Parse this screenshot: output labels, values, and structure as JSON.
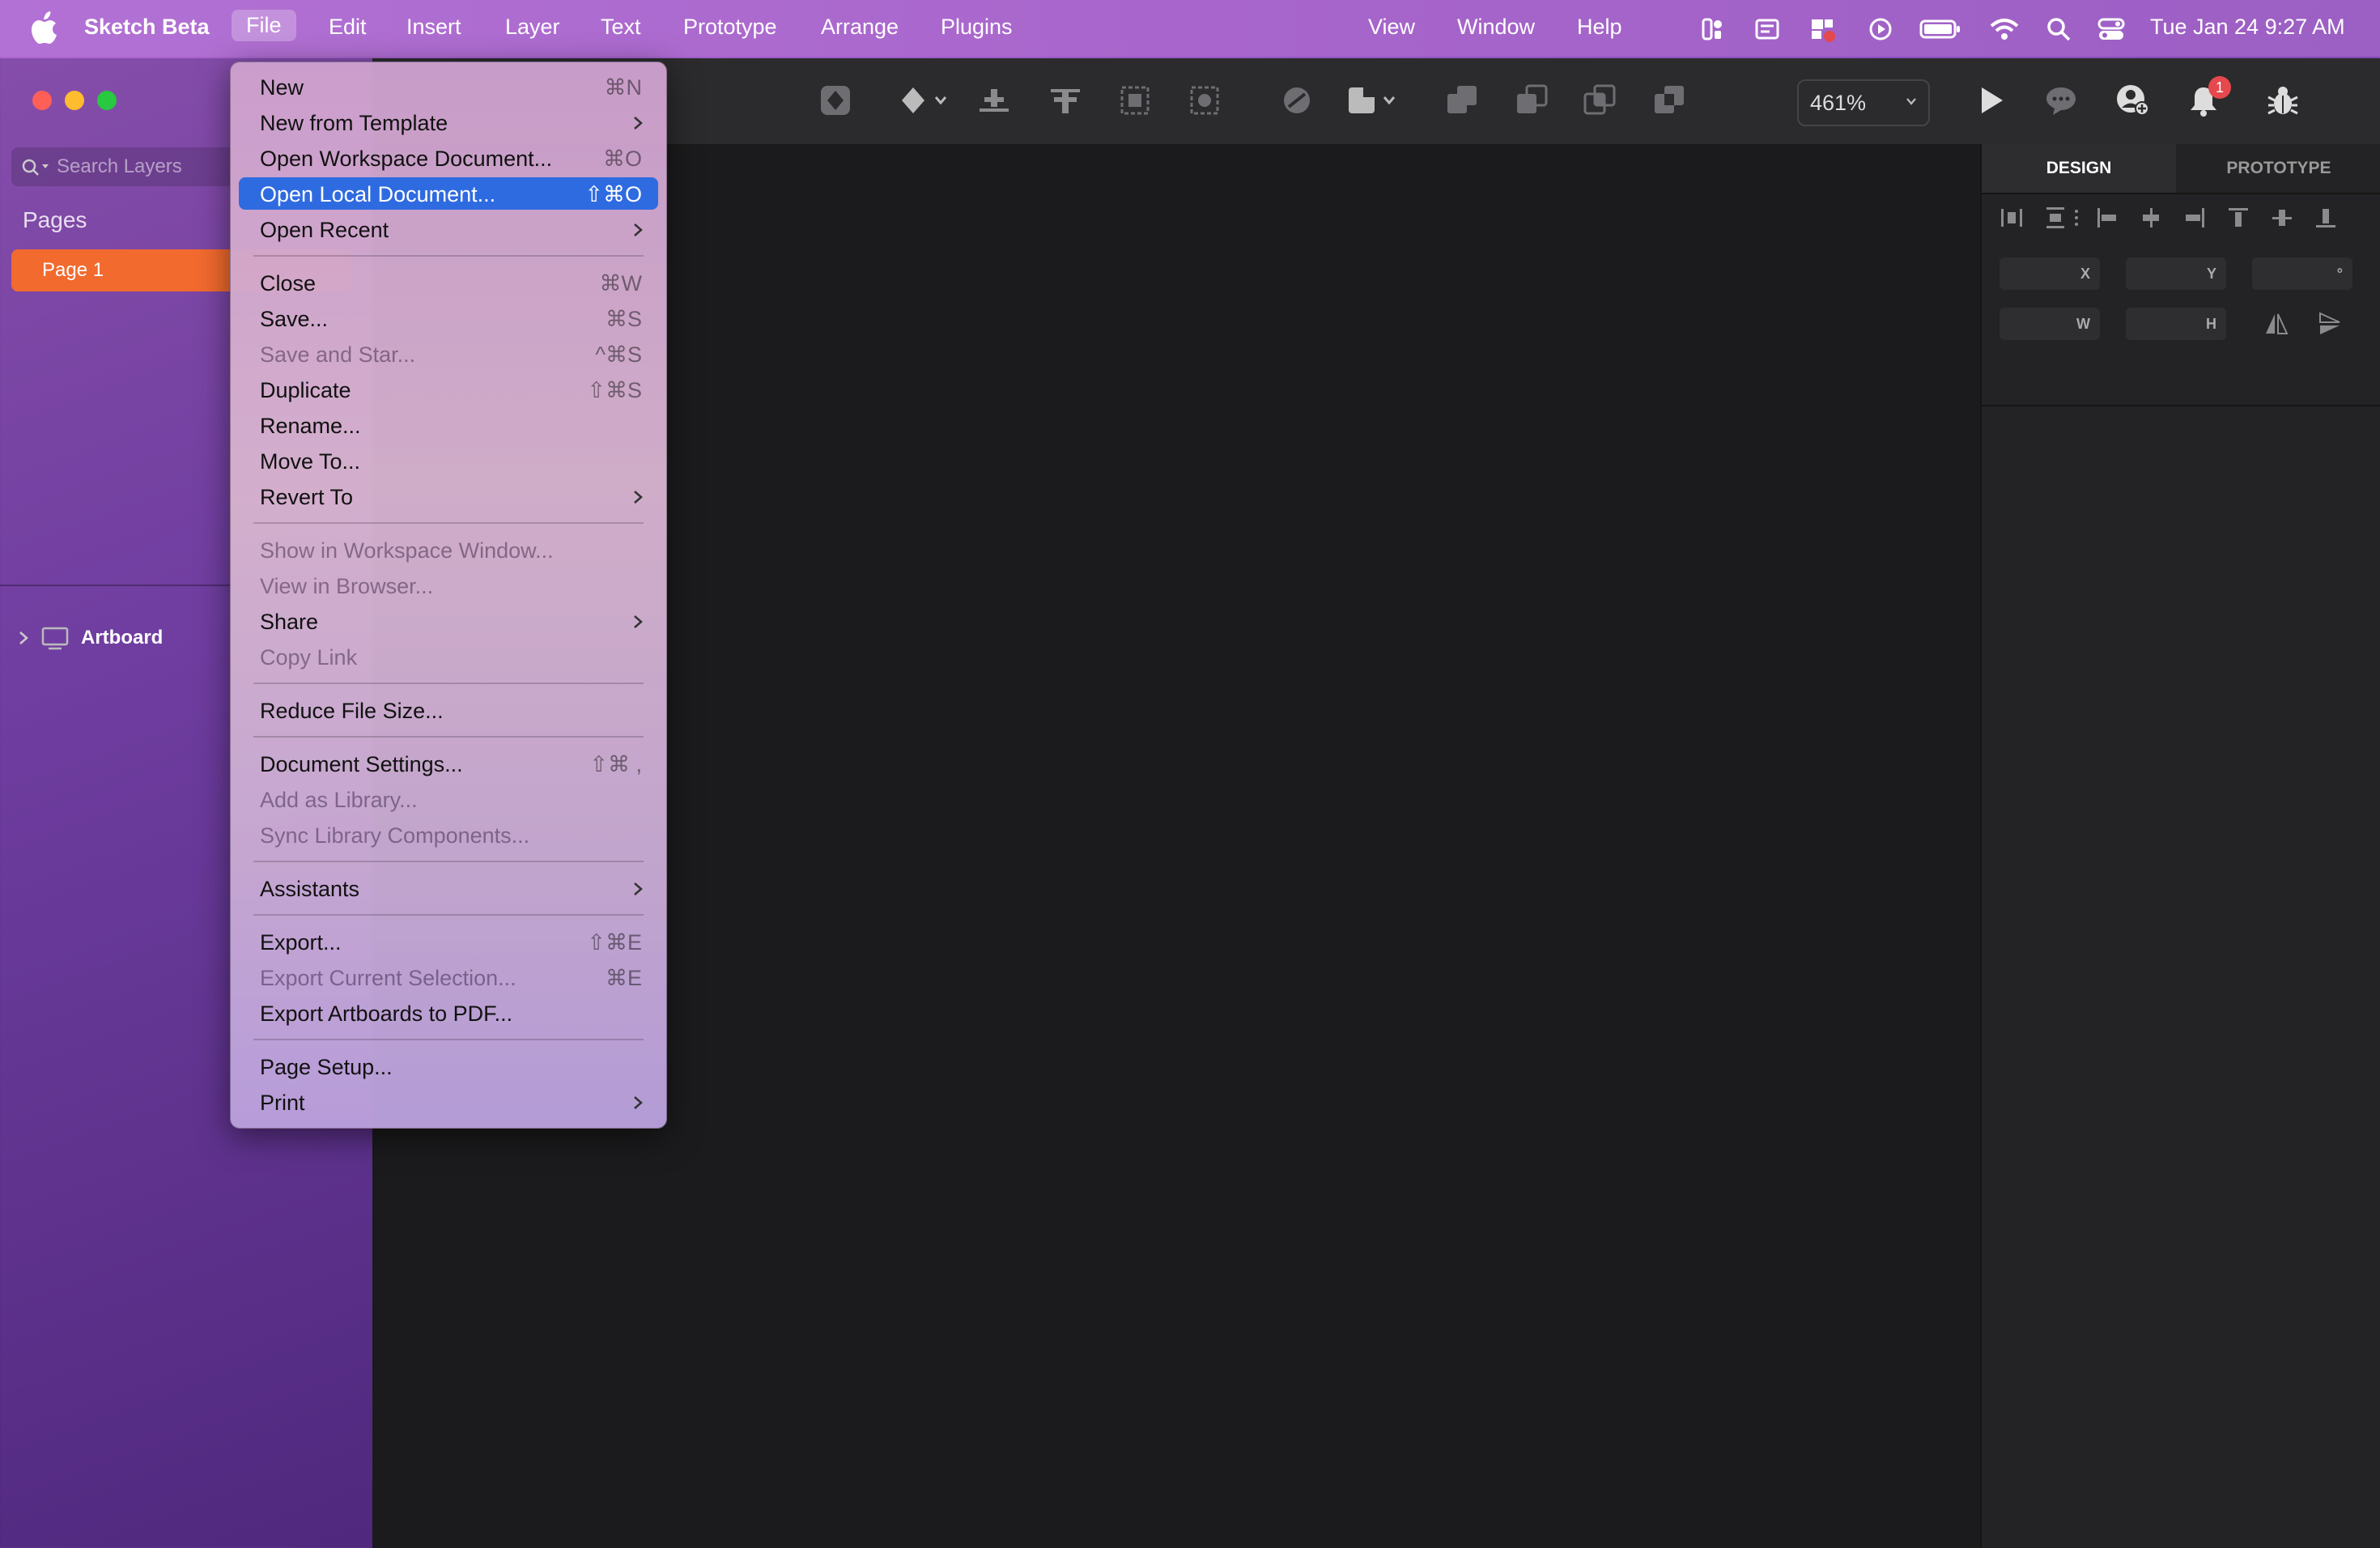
{
  "menubar": {
    "app_name": "Sketch Beta",
    "items": [
      "File",
      "Edit",
      "Insert",
      "Layer",
      "Text",
      "Prototype",
      "Arrange",
      "Plugins",
      "View",
      "Window",
      "Help"
    ],
    "datetime": "Tue Jan 24  9:27 AM"
  },
  "sidebar": {
    "search_placeholder": "Search Layers",
    "pages_title": "Pages",
    "page_item": "Page 1",
    "layer_item": "Artboard"
  },
  "toolbar": {
    "zoom": "461%",
    "notification_count": "1"
  },
  "inspector": {
    "tab_design": "DESIGN",
    "tab_prototype": "PROTOTYPE",
    "field_x": "X",
    "field_y": "Y",
    "field_rotation": "°",
    "field_w": "W",
    "field_h": "H"
  },
  "file_menu": {
    "items": [
      {
        "label": "New",
        "shortcut": "⌘N"
      },
      {
        "label": "New from Template",
        "submenu": true
      },
      {
        "label": "Open Workspace Document...",
        "shortcut": "⌘O"
      },
      {
        "label": "Open Local Document...",
        "shortcut": "⇧⌘O",
        "highlighted": true
      },
      {
        "label": "Open Recent",
        "submenu": true
      },
      {
        "label": "Close",
        "shortcut": "⌘W"
      },
      {
        "label": "Save...",
        "shortcut": "⌘S"
      },
      {
        "label": "Save and Star...",
        "shortcut": "^⌘S",
        "disabled": true
      },
      {
        "label": "Duplicate",
        "shortcut": "⇧⌘S"
      },
      {
        "label": "Rename..."
      },
      {
        "label": "Move To..."
      },
      {
        "label": "Revert To",
        "submenu": true
      },
      {
        "label": "Show in Workspace Window...",
        "disabled": true
      },
      {
        "label": "View in Browser...",
        "disabled": true
      },
      {
        "label": "Share",
        "submenu": true
      },
      {
        "label": "Copy Link",
        "disabled": true
      },
      {
        "label": "Reduce File Size..."
      },
      {
        "label": "Document Settings...",
        "shortcut": "⇧⌘ ,"
      },
      {
        "label": "Add as Library...",
        "disabled": true
      },
      {
        "label": "Sync Library Components...",
        "disabled": true
      },
      {
        "label": "Assistants",
        "submenu": true
      },
      {
        "label": "Export...",
        "shortcut": "⇧⌘E"
      },
      {
        "label": "Export Current Selection...",
        "shortcut": "⌘E",
        "disabled": true
      },
      {
        "label": "Export Artboards to PDF..."
      },
      {
        "label": "Page Setup..."
      },
      {
        "label": "Print",
        "submenu": true
      }
    ]
  },
  "colors": {
    "accent_highlight": "#2f6be0",
    "page_selected": "#f26a2e",
    "notification_badge": "#e5484d"
  }
}
